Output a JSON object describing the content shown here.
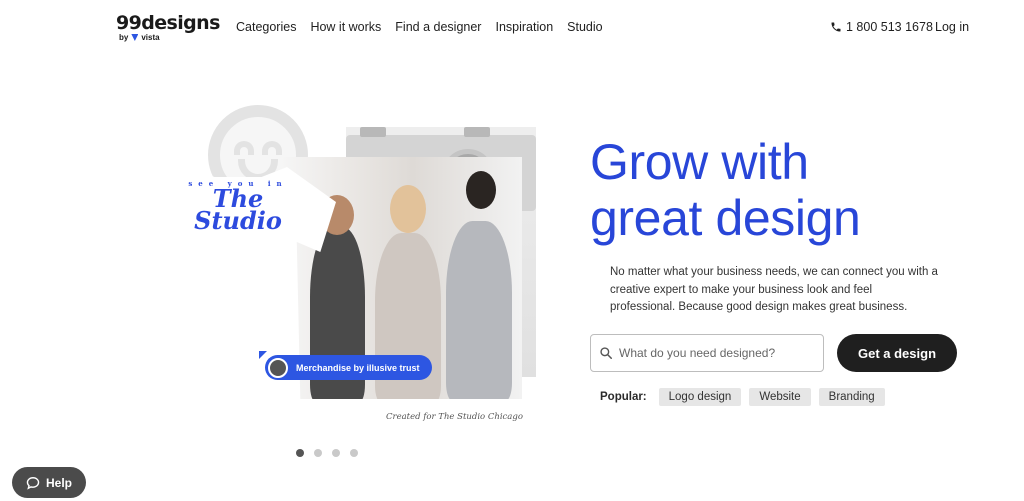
{
  "brand": {
    "name": "99designs",
    "sub": "by",
    "sub_brand": "vista"
  },
  "nav": {
    "items": [
      "Categories",
      "How it works",
      "Find a designer",
      "Inspiration",
      "Studio"
    ]
  },
  "header": {
    "phone": "1 800 513 1678",
    "login": "Log in",
    "phone_icon": "phone-icon"
  },
  "hero": {
    "title": "Grow with great design",
    "description": "No matter what your business needs, we can connect you with a creative expert to make your business look and feel professional. Because good design makes great business.",
    "search_placeholder": "What do you need designed?",
    "cta": "Get a design",
    "popular_label": "Popular:",
    "popular_chips": [
      "Logo design",
      "Website",
      "Branding"
    ]
  },
  "showcase": {
    "tshirt_small": "see you in",
    "tshirt_big": "The Studio",
    "badge": "Merchandise by illusive trust",
    "caption": "Created for The Studio Chicago",
    "slides_total": 4,
    "active_slide": 1
  },
  "help": {
    "label": "Help",
    "icon": "chat-bubble-icon"
  },
  "colors": {
    "accent": "#2846d8",
    "badge": "#2d56e2",
    "cta": "#1f1f1f"
  }
}
